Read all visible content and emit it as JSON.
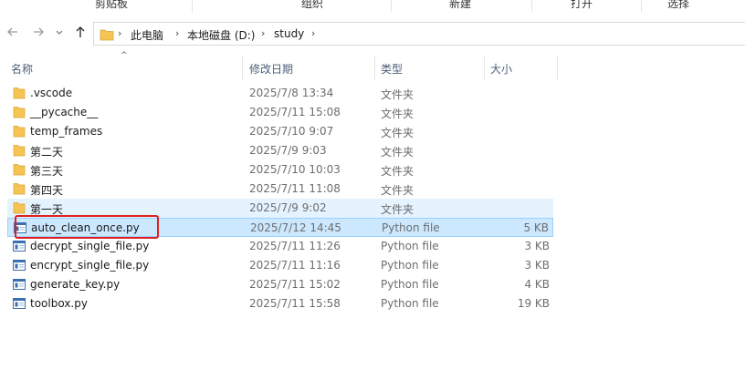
{
  "ribbon": {
    "groups": [
      "剪贴板",
      "组织",
      "新建",
      "打开",
      "选择"
    ]
  },
  "nav": {
    "back_icon": "arrow-left-icon",
    "forward_icon": "arrow-right-icon",
    "recent_icon": "chevron-down-icon",
    "up_icon": "arrow-up-icon"
  },
  "address": {
    "crumbs": [
      "此电脑",
      "本地磁盘 (D:)",
      "study"
    ],
    "separator": "›"
  },
  "columns": {
    "name": "名称",
    "modified": "修改日期",
    "type": "类型",
    "size": "大小",
    "sort_indicator": "^"
  },
  "colors": {
    "folder": "#f6c453",
    "hover_bg": "#e5f3ff",
    "selected_bg": "#cce8ff",
    "highlight_box": "#e0201e"
  },
  "files": [
    {
      "name": ".vscode",
      "date": "2025/7/8 13:34",
      "type": "文件夹",
      "size": "",
      "kind": "folder"
    },
    {
      "name": "__pycache__",
      "date": "2025/7/11 15:08",
      "type": "文件夹",
      "size": "",
      "kind": "folder"
    },
    {
      "name": "temp_frames",
      "date": "2025/7/10 9:07",
      "type": "文件夹",
      "size": "",
      "kind": "folder"
    },
    {
      "name": "第二天",
      "date": "2025/7/9 9:03",
      "type": "文件夹",
      "size": "",
      "kind": "folder"
    },
    {
      "name": "第三天",
      "date": "2025/7/10 10:03",
      "type": "文件夹",
      "size": "",
      "kind": "folder"
    },
    {
      "name": "第四天",
      "date": "2025/7/11 11:08",
      "type": "文件夹",
      "size": "",
      "kind": "folder"
    },
    {
      "name": "第一天",
      "date": "2025/7/9 9:02",
      "type": "文件夹",
      "size": "",
      "kind": "folder"
    },
    {
      "name": "auto_clean_once.py",
      "date": "2025/7/12 14:45",
      "type": "Python file",
      "size": "5 KB",
      "kind": "python"
    },
    {
      "name": "decrypt_single_file.py",
      "date": "2025/7/11 11:26",
      "type": "Python file",
      "size": "3 KB",
      "kind": "python"
    },
    {
      "name": "encrypt_single_file.py",
      "date": "2025/7/11 11:16",
      "type": "Python file",
      "size": "3 KB",
      "kind": "python"
    },
    {
      "name": "generate_key.py",
      "date": "2025/7/11 15:02",
      "type": "Python file",
      "size": "4 KB",
      "kind": "python"
    },
    {
      "name": "toolbox.py",
      "date": "2025/7/11 15:58",
      "type": "Python file",
      "size": "19 KB",
      "kind": "python"
    }
  ]
}
